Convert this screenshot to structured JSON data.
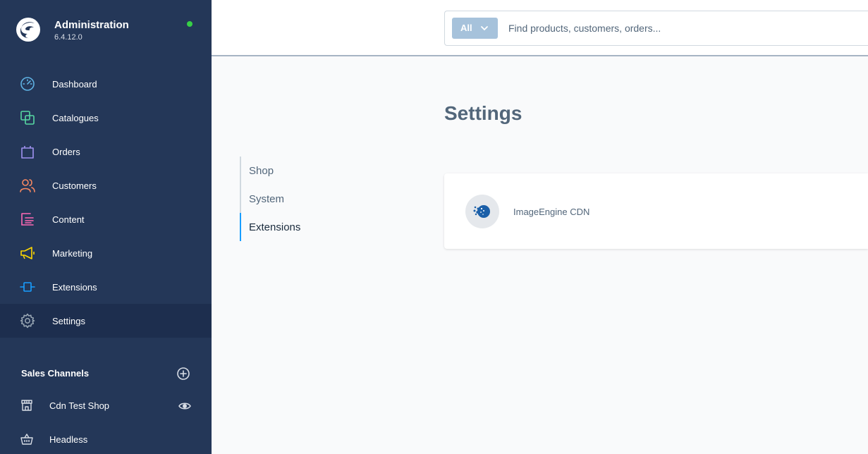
{
  "brand": {
    "title": "Administration",
    "version": "6.4.12.0"
  },
  "nav": [
    {
      "label": "Dashboard",
      "icon": "dashboard-icon",
      "color": "#57d9a3"
    },
    {
      "label": "Catalogues",
      "icon": "catalogue-icon",
      "color": "#57d9a3"
    },
    {
      "label": "Orders",
      "icon": "orders-icon",
      "color": "#a092f0"
    },
    {
      "label": "Customers",
      "icon": "customers-icon",
      "color": "#f88962"
    },
    {
      "label": "Content",
      "icon": "content-icon",
      "color": "#ff68b4"
    },
    {
      "label": "Marketing",
      "icon": "marketing-icon",
      "color": "#ffd700"
    },
    {
      "label": "Extensions",
      "icon": "extensions-icon",
      "color": "#189eff"
    },
    {
      "label": "Settings",
      "icon": "settings-icon",
      "color": "#9aa8b5"
    }
  ],
  "sales_channels": {
    "header": "Sales Channels",
    "items": [
      {
        "label": "Cdn Test Shop"
      },
      {
        "label": "Headless"
      }
    ]
  },
  "search": {
    "type_label": "All",
    "placeholder": "Find products, customers, orders..."
  },
  "page": {
    "title": "Settings"
  },
  "subnav": [
    {
      "label": "Shop"
    },
    {
      "label": "System"
    },
    {
      "label": "Extensions"
    }
  ],
  "card": {
    "item_label": "ImageEngine CDN"
  }
}
